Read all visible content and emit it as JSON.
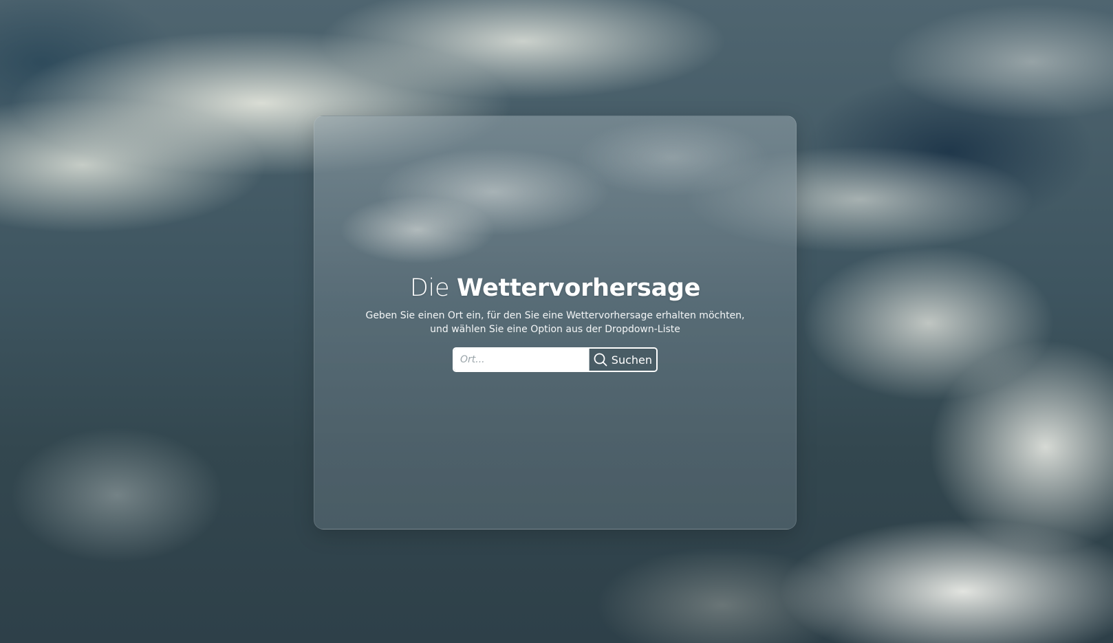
{
  "header": {
    "title_prefix": "Die",
    "title_main": "Wettervorhersage"
  },
  "intro": {
    "line1": "Geben Sie einen Ort ein, für den Sie eine Wettervorhersage erhalten möchten,",
    "line2": "und wählen Sie eine Option aus der Dropdown-Liste"
  },
  "search": {
    "placeholder": "Ort...",
    "value": "",
    "button_label": "Suchen",
    "button_icon": "search-icon"
  },
  "colors": {
    "text": "#ffffff",
    "input_background": "#ffffff",
    "button_background": "#465862"
  }
}
